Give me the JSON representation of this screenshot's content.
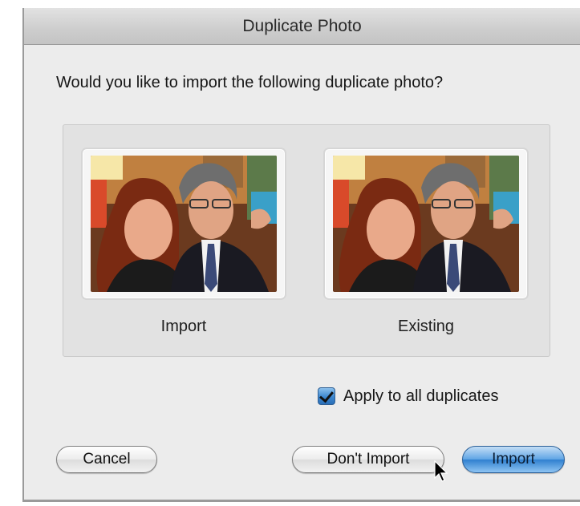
{
  "dialog": {
    "title": "Duplicate Photo",
    "question": "Would you like to import the following duplicate photo?"
  },
  "photos": {
    "left_caption": "Import",
    "right_caption": "Existing"
  },
  "options": {
    "apply_label": "Apply to all duplicates",
    "apply_checked": true
  },
  "buttons": {
    "cancel": "Cancel",
    "dont_import": "Don't Import",
    "import": "Import"
  },
  "colors": {
    "accent": "#3d87cf",
    "window_bg": "#ececec"
  }
}
